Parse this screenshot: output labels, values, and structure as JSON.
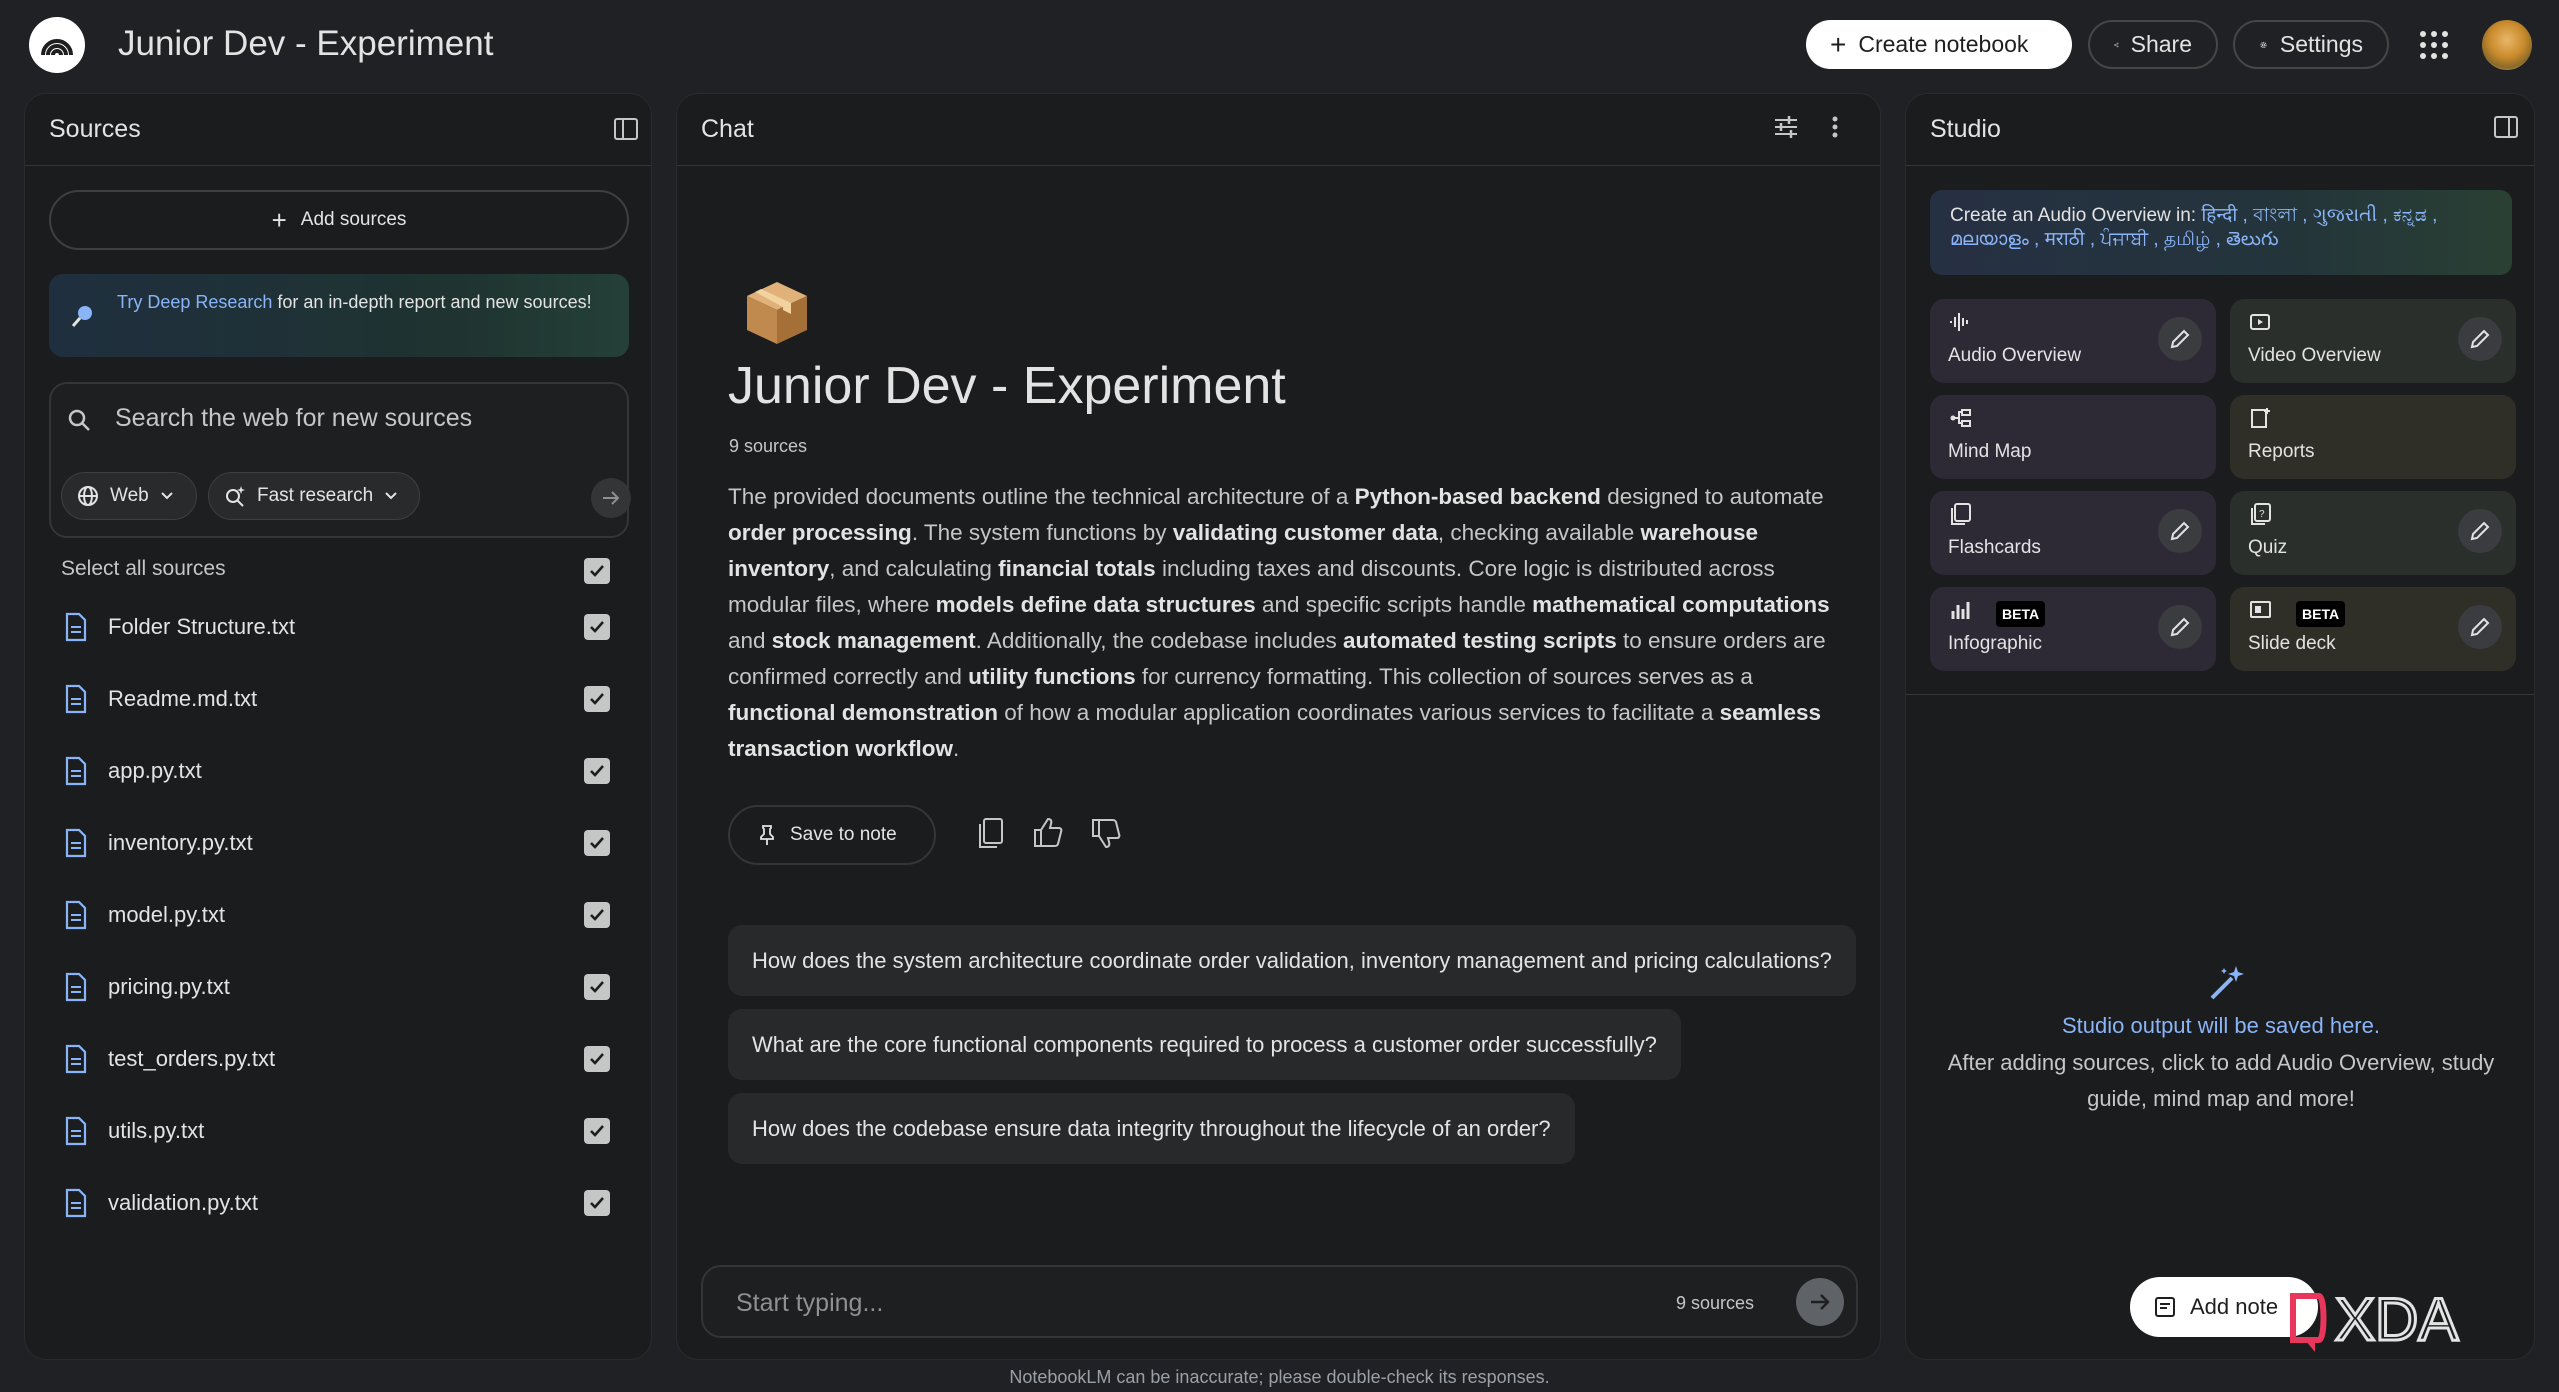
{
  "header": {
    "title": "Junior Dev - Experiment",
    "create_label": "Create notebook",
    "share_label": "Share",
    "settings_label": "Settings"
  },
  "sources": {
    "title": "Sources",
    "add_label": "Add sources",
    "deep_research_link": "Try Deep Research",
    "deep_research_text": " for an in-depth report and new sources!",
    "search_placeholder": "Search the web for new sources",
    "web_label": "Web",
    "fast_label": "Fast research",
    "select_all": "Select all sources",
    "items": [
      {
        "label": "Folder Structure.txt"
      },
      {
        "label": "Readme.md.txt"
      },
      {
        "label": "app.py.txt"
      },
      {
        "label": "inventory.py.txt"
      },
      {
        "label": "model.py.txt"
      },
      {
        "label": "pricing.py.txt"
      },
      {
        "label": "test_orders.py.txt"
      },
      {
        "label": "utils.py.txt"
      },
      {
        "label": "validation.py.txt"
      }
    ]
  },
  "chat": {
    "title": "Chat",
    "notebook_title": "Junior Dev - Experiment",
    "source_count": "9 sources",
    "summary": [
      {
        "t": "The provided documents outline the technical architecture of a ",
        "b": false
      },
      {
        "t": "Python-based backend",
        "b": true
      },
      {
        "t": " designed to automate ",
        "b": false
      },
      {
        "t": "order processing",
        "b": true
      },
      {
        "t": ". The system functions by ",
        "b": false
      },
      {
        "t": "validating customer data",
        "b": true
      },
      {
        "t": ", checking available ",
        "b": false
      },
      {
        "t": "warehouse inventory",
        "b": true
      },
      {
        "t": ", and calculating ",
        "b": false
      },
      {
        "t": "financial totals",
        "b": true
      },
      {
        "t": " including taxes and discounts. Core logic is distributed across modular files, where ",
        "b": false
      },
      {
        "t": "models define data structures",
        "b": true
      },
      {
        "t": " and specific scripts handle ",
        "b": false
      },
      {
        "t": "mathematical computations",
        "b": true
      },
      {
        "t": " and ",
        "b": false
      },
      {
        "t": "stock management",
        "b": true
      },
      {
        "t": ". Additionally, the codebase includes ",
        "b": false
      },
      {
        "t": "automated testing scripts",
        "b": true
      },
      {
        "t": " to ensure orders are confirmed correctly and ",
        "b": false
      },
      {
        "t": "utility functions",
        "b": true
      },
      {
        "t": " for currency formatting. This collection of sources serves as a ",
        "b": false
      },
      {
        "t": "functional demonstration",
        "b": true
      },
      {
        "t": " of how a modular application coordinates various services to facilitate a ",
        "b": false
      },
      {
        "t": "seamless transaction workflow",
        "b": true
      },
      {
        "t": ".",
        "b": false
      }
    ],
    "save_note_label": "Save to note",
    "suggestions": [
      "How does the system architecture coordinate order validation, inventory management and pricing calculations?",
      "What are the core functional components required to process a customer order successfully?",
      "How does the codebase ensure data integrity throughout the lifecycle of an order?"
    ],
    "input_placeholder": "Start typing...",
    "input_count": "9 sources"
  },
  "studio": {
    "title": "Studio",
    "lang_prefix": "Create an Audio Overview in: ",
    "lang_list": "हिन्दी , বাংলা , ગુજરાતી , ಕನ್ನಡ , മലയാളം , मराठी , ਪੰਜਾਬੀ , தமிழ் , తెలుగు",
    "tiles": [
      {
        "label": "Audio Overview",
        "beta": ""
      },
      {
        "label": "Video Overview",
        "beta": ""
      },
      {
        "label": "Mind Map",
        "beta": ""
      },
      {
        "label": "Reports",
        "beta": ""
      },
      {
        "label": "Flashcards",
        "beta": ""
      },
      {
        "label": "Quiz",
        "beta": ""
      },
      {
        "label": "Infographic",
        "beta": "BETA"
      },
      {
        "label": "Slide deck",
        "beta": "BETA"
      }
    ],
    "empty_title": "Studio output will be saved here.",
    "empty_sub": "After adding sources, click to add Audio Overview, study guide, mind map and more!",
    "add_note_label": "Add note"
  },
  "footer": "NotebookLM can be inaccurate; please double-check its responses.",
  "watermark": "XDA",
  "colors": {
    "accent_blue": "#8ab4f8",
    "background": "#202124",
    "panel": "#1b1c1d"
  }
}
